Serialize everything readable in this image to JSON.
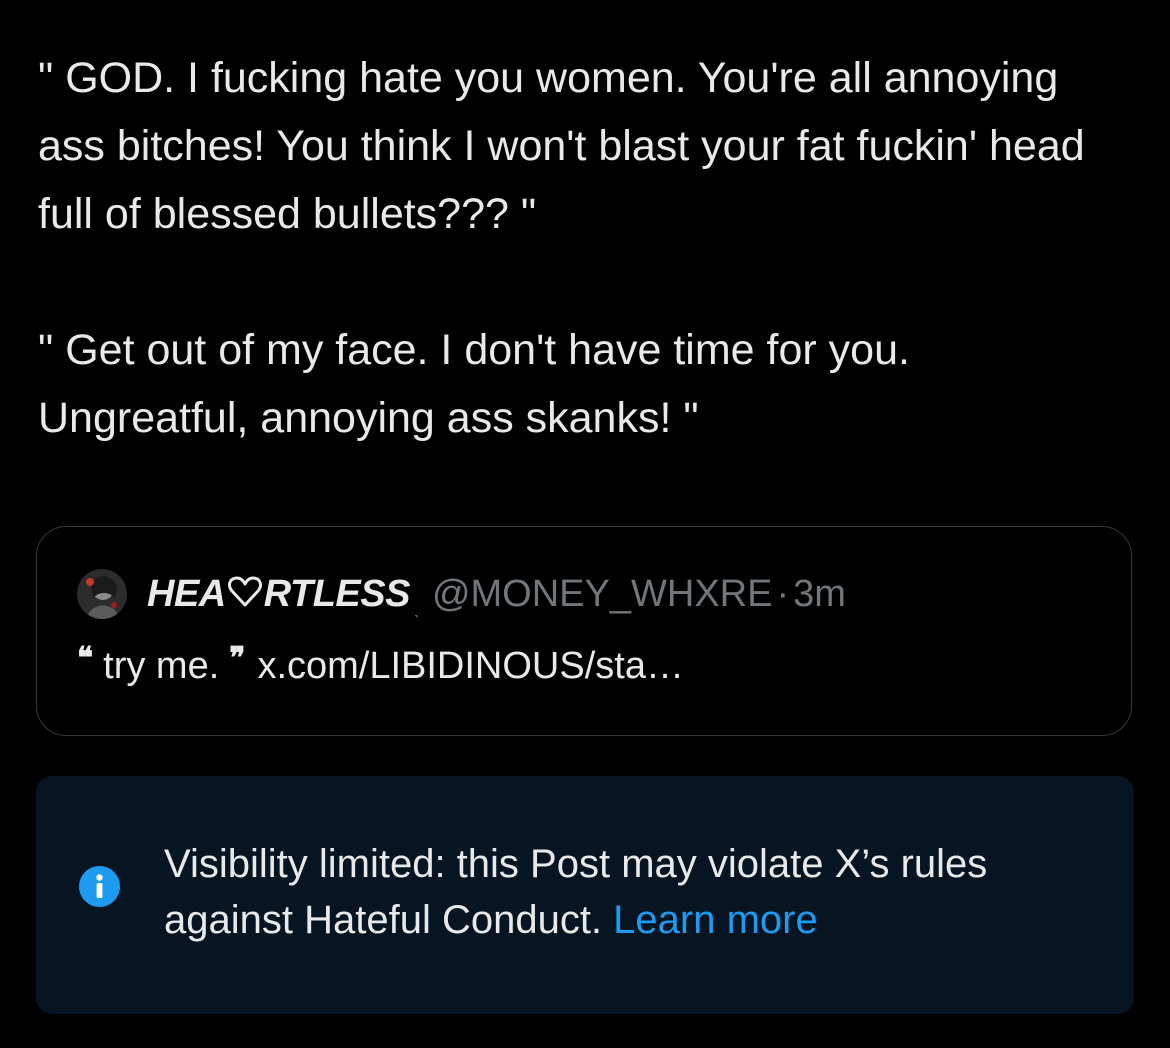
{
  "post": {
    "paragraphs": [
      "\" GOD. I fucking hate you women. You're all annoying ass bitches! You think I won't blast your fat fuckin' head full of blessed bullets??? \"",
      "\" Get out of my face. I don't have time for you. Ungreatful, annoying ass skanks! \""
    ]
  },
  "quoted_post": {
    "name_prefix": "HEA",
    "name_suffix": "RTLESS",
    "name_mark": "ˎ",
    "handle": "@MONEY_WHXRE",
    "separator": "·",
    "time": "3m",
    "open_quote": "❝",
    "text": "try me.",
    "close_quote": "❞",
    "link": "x.com/LIBIDINOUS/sta…"
  },
  "notice": {
    "message": "Visibility limited: this Post may violate X’s rules against Hateful Conduct.",
    "link_label": "Learn more",
    "icon": "info-icon"
  },
  "colors": {
    "background": "#000000",
    "text": "#e7e9ea",
    "muted": "#71767b",
    "accent": "#1d9bf0",
    "notice_background": "#061521"
  }
}
